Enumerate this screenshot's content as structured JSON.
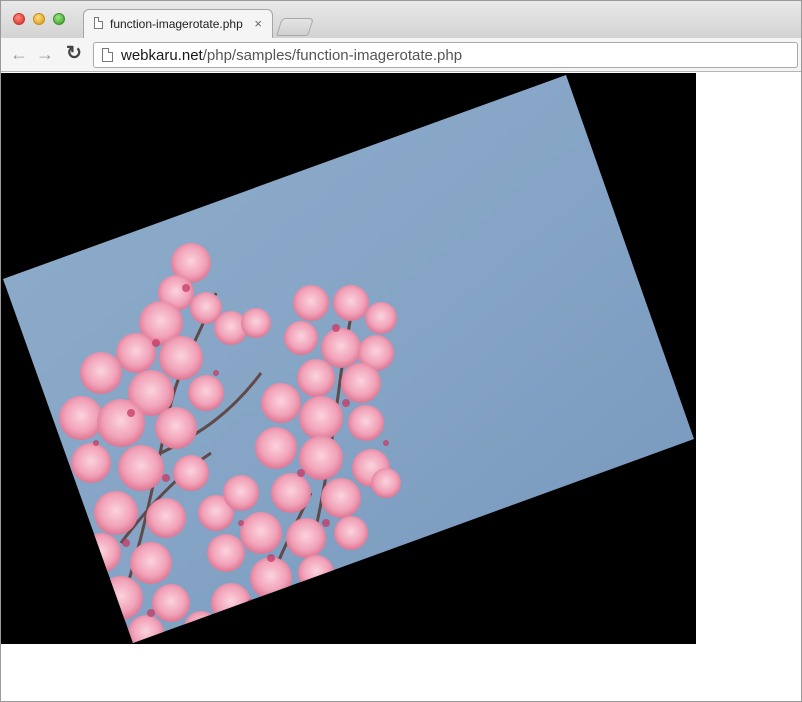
{
  "window": {
    "controls": [
      "close",
      "minimize",
      "zoom"
    ]
  },
  "tab": {
    "title": "function-imagerotate.php",
    "close_glyph": "×",
    "icon": "document-icon"
  },
  "toolbar": {
    "back_glyph": "←",
    "forward_glyph": "→",
    "reload_glyph": "↻"
  },
  "address_bar": {
    "host": "webkaru.net",
    "path": "/php/samples/function-imagerotate.php",
    "icon": "page-icon"
  },
  "content": {
    "image_subject": "pink cherry blossoms against blue sky",
    "background_color": "#000000",
    "sky_color": "#8aa8c8"
  }
}
